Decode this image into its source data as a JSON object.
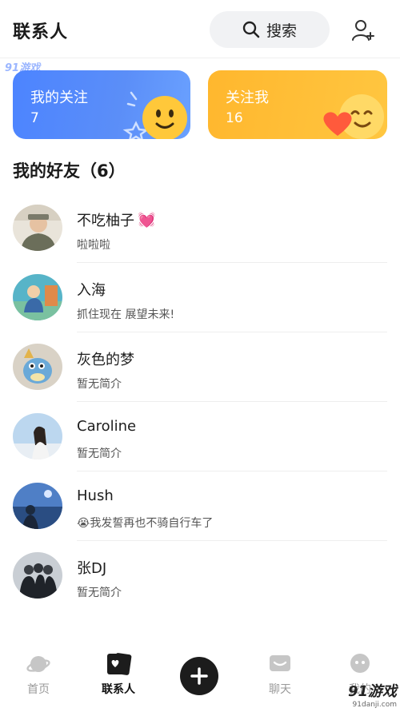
{
  "header": {
    "title": "联系人",
    "search_label": "搜索"
  },
  "watermark": {
    "top": "91游戏",
    "brand": "91游戏",
    "site": "91danji.com"
  },
  "cards": [
    {
      "label": "我的关注",
      "count": "7",
      "color": "#4c84ff"
    },
    {
      "label": "关注我",
      "count": "16",
      "color": "#ffb72e"
    }
  ],
  "friends": {
    "title": "我的好友（6）",
    "items": [
      {
        "name": "不吃柚子",
        "bio": "啦啦啦",
        "emoji": "💓"
      },
      {
        "name": "入海",
        "bio": "抓住现在 展望未来!"
      },
      {
        "name": "灰色的梦",
        "bio": "暂无简介"
      },
      {
        "name": "Caroline",
        "bio": "暂无简介"
      },
      {
        "name": "Hush",
        "bio": "我发誓再也不骑自行车了",
        "emoji": "😭"
      },
      {
        "name": "张DJ",
        "bio": "暂无简介"
      }
    ]
  },
  "tabbar": {
    "home": "首页",
    "contacts": "联系人",
    "chat": "聊天",
    "mine": "我的"
  }
}
